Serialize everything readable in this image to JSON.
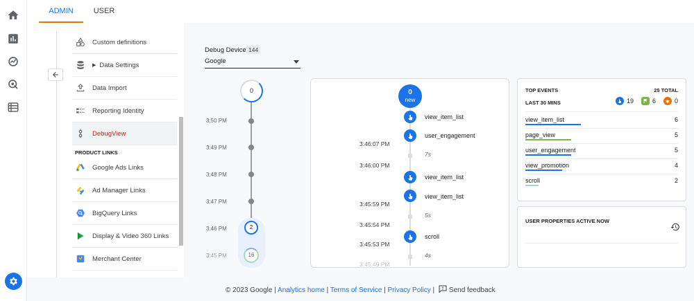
{
  "tabs": [
    {
      "label": "ADMIN",
      "active": true
    },
    {
      "label": "USER",
      "active": false
    }
  ],
  "rail": {
    "icons": [
      "home-icon",
      "reports-icon",
      "explore-icon",
      "advertising-icon",
      "configure-icon"
    ],
    "settings_icon": "gear-icon"
  },
  "admin_nav": {
    "items": [
      {
        "label": "Custom definitions",
        "icon": "shapes-icon"
      },
      {
        "label": "Data Settings",
        "icon": "database-icon",
        "expandable": true
      },
      {
        "label": "Data Import",
        "icon": "upload-icon"
      },
      {
        "label": "Reporting Identity",
        "icon": "identity-icon"
      },
      {
        "label": "DebugView",
        "icon": "debug-icon",
        "active": true
      }
    ],
    "section_title": "PRODUCT LINKS",
    "product_links": [
      {
        "label": "Google Ads Links",
        "icon": "google-ads-icon"
      },
      {
        "label": "Ad Manager Links",
        "icon": "ad-manager-icon"
      },
      {
        "label": "BigQuery Links",
        "icon": "bigquery-icon"
      },
      {
        "label": "Display & Video 360 Links",
        "icon": "dv360-icon"
      },
      {
        "label": "Merchant Center",
        "icon": "merchant-center-icon"
      }
    ]
  },
  "debug": {
    "device_label": "Debug Device",
    "device_count": "144",
    "device_value": "Google"
  },
  "minutes": {
    "top_count": "0",
    "labels": [
      "3:50 PM",
      "3:49 PM",
      "3:48 PM",
      "3:47 PM",
      "3:46 PM",
      "3:45 PM"
    ],
    "badge_346": "2",
    "badge_345": "16"
  },
  "stream": {
    "new_count": "0",
    "new_label": "new",
    "events": [
      {
        "name": "view_item_list"
      },
      {
        "name": "user_engagement"
      },
      {
        "name": "view_item_list"
      },
      {
        "name": "view_item_list"
      },
      {
        "name": "scroll"
      }
    ],
    "times": [
      "3:46:07 PM",
      "3:46:00 PM",
      "3:45:59 PM",
      "3:45:54 PM",
      "3:45:53 PM",
      "3:45:49 PM"
    ],
    "gaps": [
      "7s",
      "5s",
      "4s"
    ]
  },
  "top_events": {
    "title": "TOP EVENTS",
    "total": "25 TOTAL",
    "period": "LAST 30 MINS",
    "counts": {
      "events": "19",
      "conversions": "6",
      "errors": "0"
    },
    "rows": [
      {
        "name": "view_item_list",
        "value": "6",
        "color": "#1a73e8"
      },
      {
        "name": "page_view",
        "value": "5",
        "color": "#7cb342"
      },
      {
        "name": "user_engagement",
        "value": "5",
        "color": "#1a73e8"
      },
      {
        "name": "view_promotion",
        "value": "4",
        "color": "#1a73e8"
      },
      {
        "name": "scroll",
        "value": "2",
        "color": "#a6c8ff"
      }
    ]
  },
  "user_properties": {
    "title": "USER PROPERTIES ACTIVE NOW"
  },
  "footer": {
    "copyright": "© 2023 Google |",
    "analytics_home": "Analytics home",
    "sep1": "|",
    "terms": "Terms of Service",
    "sep2": "|",
    "privacy": "Privacy Policy",
    "sep3": "|",
    "feedback": "Send feedback"
  },
  "colors": {
    "accent": "#1a73e8",
    "active_tab_underline": "#e37400",
    "debugview_active": "#c5221f",
    "conversion": "#7cb342",
    "error": "#e8710a"
  }
}
